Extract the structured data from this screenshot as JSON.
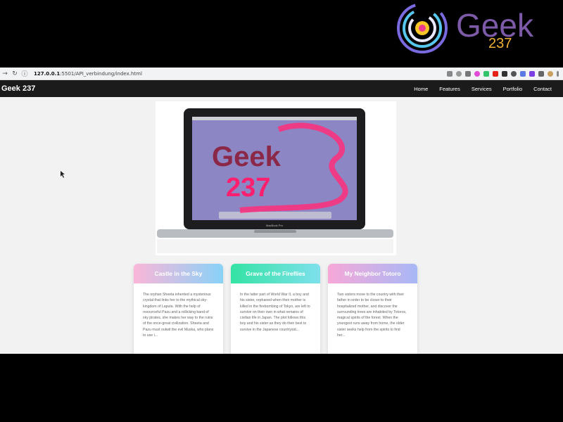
{
  "logo": {
    "text_geek": "Geek",
    "text_num": "237",
    "icon": "geek237-logo-icon"
  },
  "browser": {
    "url_host": "127.0.0.1",
    "url_port_path": ":5501/API_verbindung/index.html",
    "icons": [
      "back-arrow-icon",
      "reload-icon",
      "info-icon"
    ]
  },
  "nav": {
    "brand": "Geek 237",
    "items": [
      "Home",
      "Features",
      "Services",
      "Portfolio",
      "Contact"
    ]
  },
  "hero": {
    "screen_text_1": "Geek",
    "screen_text_2": "237",
    "laptop_label": "MacBook Pro"
  },
  "cards": [
    {
      "title": "Castle in the Sky",
      "text": "The orphan Sheeta inherited a mysterious crystal that links her to the mythical sky-kingdom of Laputa. With the help of resourceful Pazu and a rollicking band of sky pirates, she makes her way to the ruins of the once-great civilization. Sheeta and Pazu must outwit the evil Muska, who plans to use i..."
    },
    {
      "title": "Grave of the Fireflies",
      "text": "In the latter part of World War II, a boy and his sister, orphaned when their mother is killed in the firebombing of Tokyo, are left to survive on their own in what remains of civilian life in Japan. The plot follows this boy and his sister as they do their best to survive in the Japanese countrysid..."
    },
    {
      "title": "My Neighbor Totoro",
      "text": "Two sisters move to the country with their father in order to be closer to their hospitalized mother, and discover the surrounding trees are inhabited by Totoros, magical spirits of the forest. When the youngest runs away from home, the older sister seeks help from the spirits to find her..."
    }
  ],
  "colors": {
    "nav_bg": "#1b1b1b",
    "page_bg": "#f2f2f2",
    "accent_pink": "#ff2e7a",
    "accent_purple": "#6b3fa0"
  }
}
